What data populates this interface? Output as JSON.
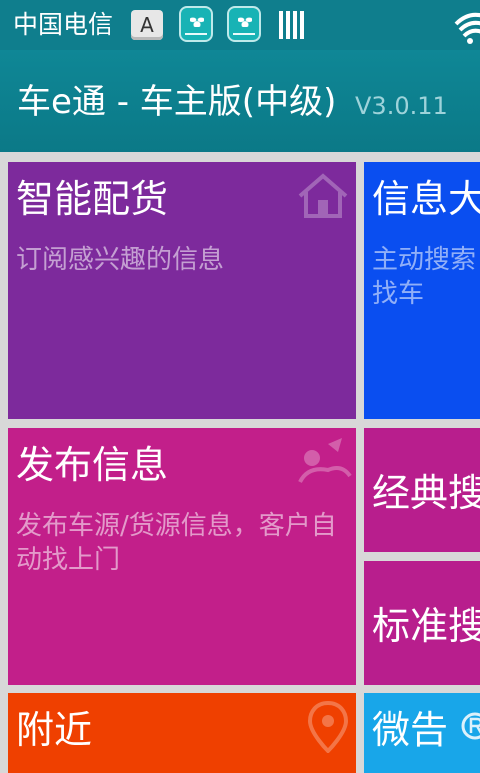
{
  "statusbar": {
    "carrier": "中国电信",
    "input_method_letter": "A"
  },
  "header": {
    "title": "车e通 - 车主版(中级)",
    "version": "V3.0.11"
  },
  "tiles": {
    "smart": {
      "title": "智能配货",
      "subtitle": "订阅感兴趣的信息",
      "color": "#7d2a9c",
      "icon": "house-icon"
    },
    "info": {
      "title": "信息大",
      "subtitle": "主动搜索找车",
      "color": "#0a4ef0"
    },
    "publish": {
      "title": "发布信息",
      "subtitle": "发布车源/货源信息，客户自动找上门",
      "color": "#c21f8a",
      "icon": "person-icon"
    },
    "classic": {
      "title": "经典搜",
      "color": "#b81e8d"
    },
    "standard": {
      "title": "标准搜",
      "color": "#b81e8d"
    },
    "nearby": {
      "title": "附近",
      "color": "#ef4000",
      "icon": "map-pin-icon"
    },
    "weigo": {
      "title": "微告",
      "color": "#18a6e9"
    }
  }
}
